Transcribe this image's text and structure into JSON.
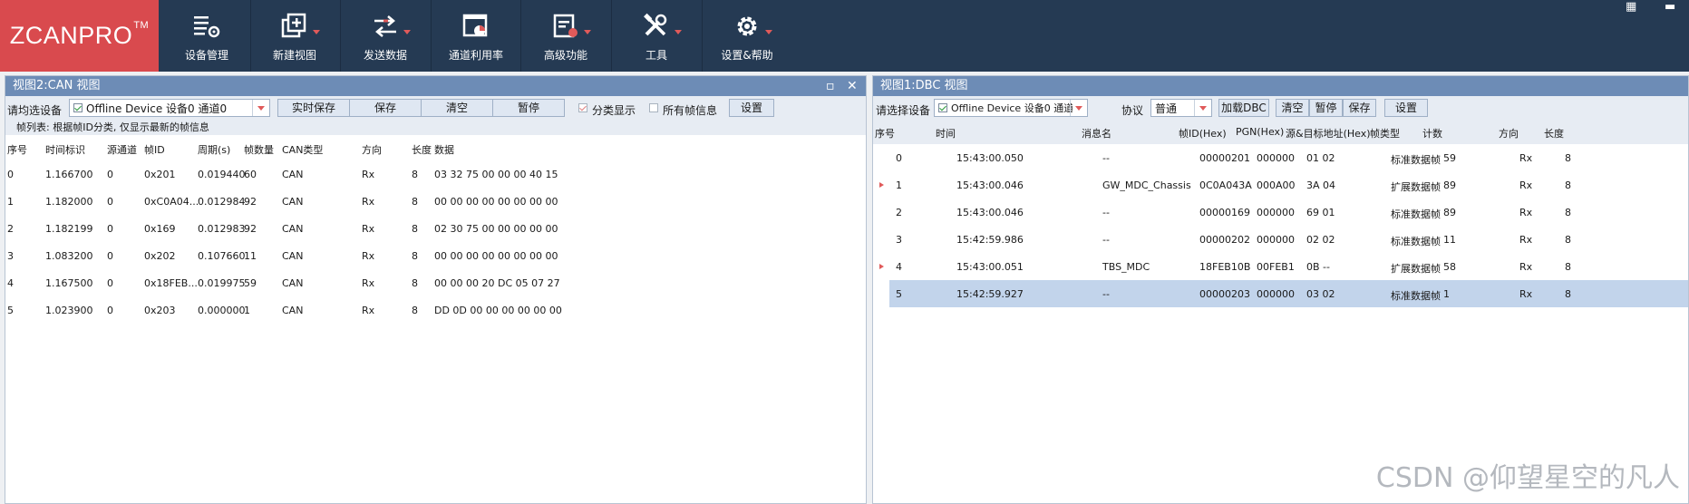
{
  "app": {
    "logo": "ZCANPRO",
    "logo_tm": "TM",
    "toolbar": [
      {
        "label": "设备管理",
        "icon": "device-manage-icon",
        "has_arrow": false
      },
      {
        "label": "新建视图",
        "icon": "new-view-icon",
        "has_arrow": true
      },
      {
        "label": "发送数据",
        "icon": "send-data-icon",
        "has_arrow": true
      },
      {
        "label": "通道利用率",
        "icon": "channel-usage-icon",
        "has_arrow": false
      },
      {
        "label": "高级功能",
        "icon": "advanced-icon",
        "has_arrow": true
      },
      {
        "label": "工具",
        "icon": "tools-icon",
        "has_arrow": true
      },
      {
        "label": "设置&帮助",
        "icon": "settings-help-icon",
        "has_arrow": true
      }
    ],
    "accent": "#d94a4e",
    "toolbar_bg": "#253a53"
  },
  "left_panel": {
    "title": "视图2:CAN 视图",
    "select_label": "请均选设备",
    "device": "Offline Device 设备0 通道0",
    "buttons": {
      "realtime_save": "实时保存",
      "save": "保存",
      "clear": "清空",
      "pause": "暂停",
      "settings": "设置"
    },
    "classify_label": "分类显示",
    "all_frames_label": "所有帧信息",
    "info": "帧列表: 根据帧ID分类, 仅显示最新的帧信息",
    "columns": [
      "序号",
      "时间标识",
      "源通道",
      "帧ID",
      "周期(s)",
      "帧数量",
      "CAN类型",
      "方向",
      "长度",
      "数据"
    ],
    "rows": [
      [
        "0",
        "1.166700",
        "0",
        "0x201",
        "0.019440",
        "60",
        "CAN",
        "Rx",
        "8",
        "03 32 75 00 00 00 40 15"
      ],
      [
        "1",
        "1.182000",
        "0",
        "0xC0A04...",
        "0.012984",
        "92",
        "CAN",
        "Rx",
        "8",
        "00 00 00 00 00 00 00 00"
      ],
      [
        "2",
        "1.182199",
        "0",
        "0x169",
        "0.012983",
        "92",
        "CAN",
        "Rx",
        "8",
        "02 30 75 00 00 00 00 00"
      ],
      [
        "3",
        "1.083200",
        "0",
        "0x202",
        "0.107660",
        "11",
        "CAN",
        "Rx",
        "8",
        "00 00 00 00 00 00 00 00"
      ],
      [
        "4",
        "1.167500",
        "0",
        "0x18FEB...",
        "0.019975",
        "59",
        "CAN",
        "Rx",
        "8",
        "00 00 00 20 DC 05 07 27"
      ],
      [
        "5",
        "1.023900",
        "0",
        "0x203",
        "0.000000",
        "1",
        "CAN",
        "Rx",
        "8",
        "DD 0D 00 00 00 00 00 00"
      ]
    ]
  },
  "right_panel": {
    "title": "视图1:DBC 视图",
    "select_label": "请选择设备",
    "device": "Offline Device 设备0 通道0",
    "protocol_label": "协议",
    "protocol": "普通",
    "buttons": {
      "load_dbc": "加载DBC",
      "clear": "清空",
      "pause": "暂停",
      "save": "保存",
      "settings": "设置"
    },
    "columns": [
      "序号",
      "时间",
      "消息名",
      "帧ID(Hex)",
      "PGN(Hex)",
      "源&目标地址(Hex)",
      "帧类型",
      "计数",
      "方向",
      "长度"
    ],
    "rows": [
      {
        "cells": [
          "0",
          "15:43:00.050",
          "--",
          "00000201",
          "000000",
          "01 02",
          "标准数据帧",
          "59",
          "Rx",
          "8"
        ],
        "marker": false,
        "selected": false
      },
      {
        "cells": [
          "1",
          "15:43:00.046",
          "GW_MDC_Chassis",
          "0C0A043A",
          "000A00",
          "3A 04",
          "扩展数据帧",
          "89",
          "Rx",
          "8"
        ],
        "marker": true,
        "selected": false
      },
      {
        "cells": [
          "2",
          "15:43:00.046",
          "--",
          "00000169",
          "000000",
          "69 01",
          "标准数据帧",
          "89",
          "Rx",
          "8"
        ],
        "marker": false,
        "selected": false
      },
      {
        "cells": [
          "3",
          "15:42:59.986",
          "--",
          "00000202",
          "000000",
          "02 02",
          "标准数据帧",
          "11",
          "Rx",
          "8"
        ],
        "marker": false,
        "selected": false
      },
      {
        "cells": [
          "4",
          "15:43:00.051",
          "TBS_MDC",
          "18FEB10B",
          "00FEB1",
          "0B --",
          "扩展数据帧",
          "58",
          "Rx",
          "8"
        ],
        "marker": true,
        "selected": false
      },
      {
        "cells": [
          "5",
          "15:42:59.927",
          "--",
          "00000203",
          "000000",
          "03 02",
          "标准数据帧",
          "1",
          "Rx",
          "8"
        ],
        "marker": false,
        "selected": true
      }
    ]
  },
  "watermark": "CSDN @仰望星空的凡人"
}
